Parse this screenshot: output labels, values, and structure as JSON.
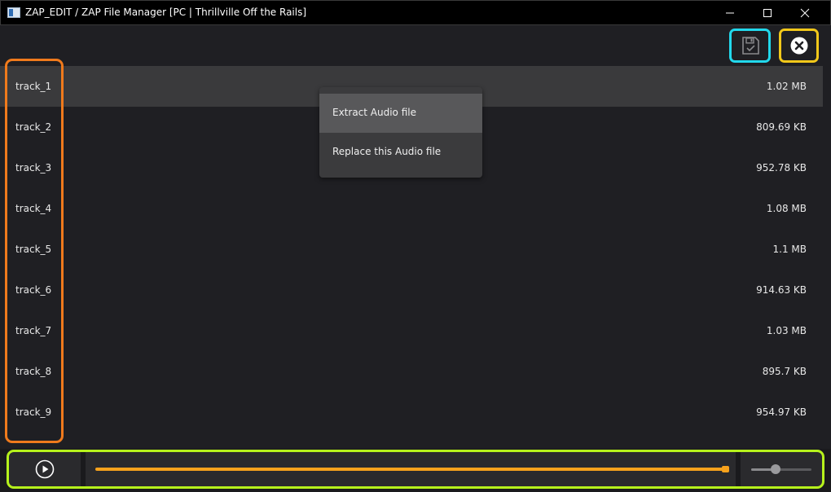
{
  "window": {
    "title": "ZAP_EDIT / ZAP File Manager  [PC | Thrillville Off the Rails]"
  },
  "toolbar": {
    "save_icon": "save-icon",
    "close_icon": "close-circle-icon"
  },
  "tracks": [
    {
      "name": "track_1",
      "size": "1.02 MB",
      "selected": true
    },
    {
      "name": "track_2",
      "size": "809.69 KB"
    },
    {
      "name": "track_3",
      "size": "952.78 KB"
    },
    {
      "name": "track_4",
      "size": "1.08 MB"
    },
    {
      "name": "track_5",
      "size": "1.1 MB"
    },
    {
      "name": "track_6",
      "size": "914.63 KB"
    },
    {
      "name": "track_7",
      "size": "1.03 MB"
    },
    {
      "name": "track_8",
      "size": "895.7 KB"
    },
    {
      "name": "track_9",
      "size": "954.97 KB"
    }
  ],
  "context_menu": {
    "items": [
      "Extract Audio file",
      "Replace this Audio file"
    ]
  },
  "player": {
    "play_icon": "play-icon",
    "seek_progress": 1.0,
    "volume_level": 0.4
  },
  "colors": {
    "highlight_orange": "#f07a1c",
    "highlight_cyan": "#22d8ec",
    "highlight_yellow": "#f2c81a",
    "highlight_lime": "#b6f21c",
    "seek_accent": "#f7a21c"
  }
}
